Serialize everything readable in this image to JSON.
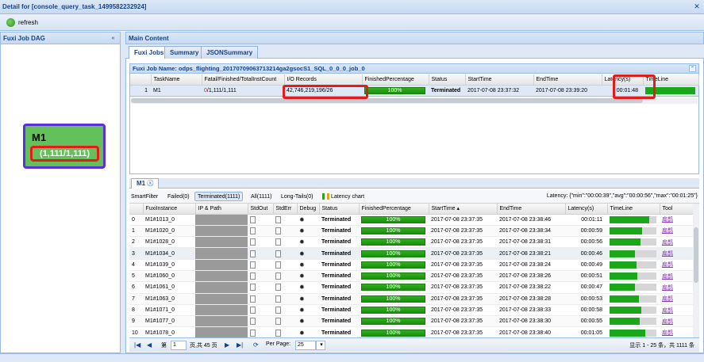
{
  "window": {
    "title": "Detail for [console_query_task_1499582232924]",
    "close_icon": "close-icon"
  },
  "toolbar": {
    "refresh_label": "refresh"
  },
  "left_panel": {
    "title": "Fuxi Job DAG",
    "collapse_glyph": "«",
    "node": {
      "name": "M1",
      "counts": "(1,111/1,111)"
    }
  },
  "main": {
    "title": "Main Content",
    "tabs": [
      {
        "label": "Fuxi Jobs",
        "active": true
      },
      {
        "label": "Summary",
        "active": false
      },
      {
        "label": "JSONSummary",
        "active": false
      }
    ],
    "job_panel": {
      "title": "Fuxi Job Name: odps_flighting_20170709063713214ga2gsocS1_SQL_0_0_0_job_0",
      "toggle_glyph": "⌃",
      "columns": [
        "",
        "TaskName",
        "Fatal/Finished/TotalInstCount",
        "I/O Records",
        "FinishedPercentage",
        "Status",
        "StartTime",
        "EndTime",
        "Latency(s)",
        "TimeLine"
      ],
      "row": {
        "index": "1",
        "task": "M1",
        "fatal": "0",
        "finished_total": "/1,111/1,111",
        "io_records": "42,746,219,196/26",
        "finished_pct": "100%",
        "status": "Terminated",
        "start": "2017-07-08 23:37:32",
        "end": "2017-07-08 23:39:20",
        "latency": "00:01:48"
      }
    },
    "instance_panel": {
      "tab_label": "M1",
      "filters": [
        "SmartFilter",
        "Failed(0)",
        "Terminated(1111)",
        "All(1111)",
        "Long-Tails(0)",
        "Latency chart"
      ],
      "active_filter": "Terminated(1111)",
      "latency_summary": "Latency: {\"min\":\"00:00:39\",\"avg\":\"00:00:56\",\"max\":\"00:01:25\"}",
      "columns": [
        "",
        "FuxiInstance",
        "IP & Path",
        "StdOut",
        "StdErr",
        "Debug",
        "Status",
        "FinishedPercentage",
        "StartTime ▴",
        "EndTime",
        "Latency(s)",
        "TimeLine",
        "Tool"
      ],
      "tool_label": "扁鹊",
      "rows": [
        {
          "idx": "0",
          "inst": "M1#1013_0",
          "status": "Terminated",
          "pct": "100%",
          "start": "2017-07-08 23:37:35",
          "end": "2017-07-08 23:38:46",
          "lat": "00:01:11",
          "fill": 0.84
        },
        {
          "idx": "1",
          "inst": "M1#1020_0",
          "status": "Terminated",
          "pct": "100%",
          "start": "2017-07-08 23:37:35",
          "end": "2017-07-08 23:38:34",
          "lat": "00:00:59",
          "fill": 0.69
        },
        {
          "idx": "2",
          "inst": "M1#1028_0",
          "status": "Terminated",
          "pct": "100%",
          "start": "2017-07-08 23:37:35",
          "end": "2017-07-08 23:38:31",
          "lat": "00:00:56",
          "fill": 0.66
        },
        {
          "idx": "3",
          "inst": "M1#1034_0",
          "status": "Terminated",
          "pct": "100%",
          "start": "2017-07-08 23:37:35",
          "end": "2017-07-08 23:38:21",
          "lat": "00:00:46",
          "fill": 0.54
        },
        {
          "idx": "4",
          "inst": "M1#1039_0",
          "status": "Terminated",
          "pct": "100%",
          "start": "2017-07-08 23:37:35",
          "end": "2017-07-08 23:38:24",
          "lat": "00:00:49",
          "fill": 0.58
        },
        {
          "idx": "5",
          "inst": "M1#1060_0",
          "status": "Terminated",
          "pct": "100%",
          "start": "2017-07-08 23:37:35",
          "end": "2017-07-08 23:38:26",
          "lat": "00:00:51",
          "fill": 0.6
        },
        {
          "idx": "6",
          "inst": "M1#1061_0",
          "status": "Terminated",
          "pct": "100%",
          "start": "2017-07-08 23:37:35",
          "end": "2017-07-08 23:38:22",
          "lat": "00:00:47",
          "fill": 0.55
        },
        {
          "idx": "7",
          "inst": "M1#1063_0",
          "status": "Terminated",
          "pct": "100%",
          "start": "2017-07-08 23:37:35",
          "end": "2017-07-08 23:38:28",
          "lat": "00:00:53",
          "fill": 0.62
        },
        {
          "idx": "8",
          "inst": "M1#1071_0",
          "status": "Terminated",
          "pct": "100%",
          "start": "2017-07-08 23:37:35",
          "end": "2017-07-08 23:38:33",
          "lat": "00:00:58",
          "fill": 0.68
        },
        {
          "idx": "9",
          "inst": "M1#1077_0",
          "status": "Terminated",
          "pct": "100%",
          "start": "2017-07-08 23:37:35",
          "end": "2017-07-08 23:38:30",
          "lat": "00:00:55",
          "fill": 0.65
        },
        {
          "idx": "10",
          "inst": "M1#1078_0",
          "status": "Terminated",
          "pct": "100%",
          "start": "2017-07-08 23:37:35",
          "end": "2017-07-08 23:38:40",
          "lat": "00:01:05",
          "fill": 0.76
        }
      ],
      "pager": {
        "page_label": "第",
        "page_value": "1",
        "page_total": "页,共 45 页",
        "per_page_label": "Per Page:",
        "per_page_value": "25",
        "summary": "显示 1 - 25 条，共 1111 条"
      }
    }
  }
}
